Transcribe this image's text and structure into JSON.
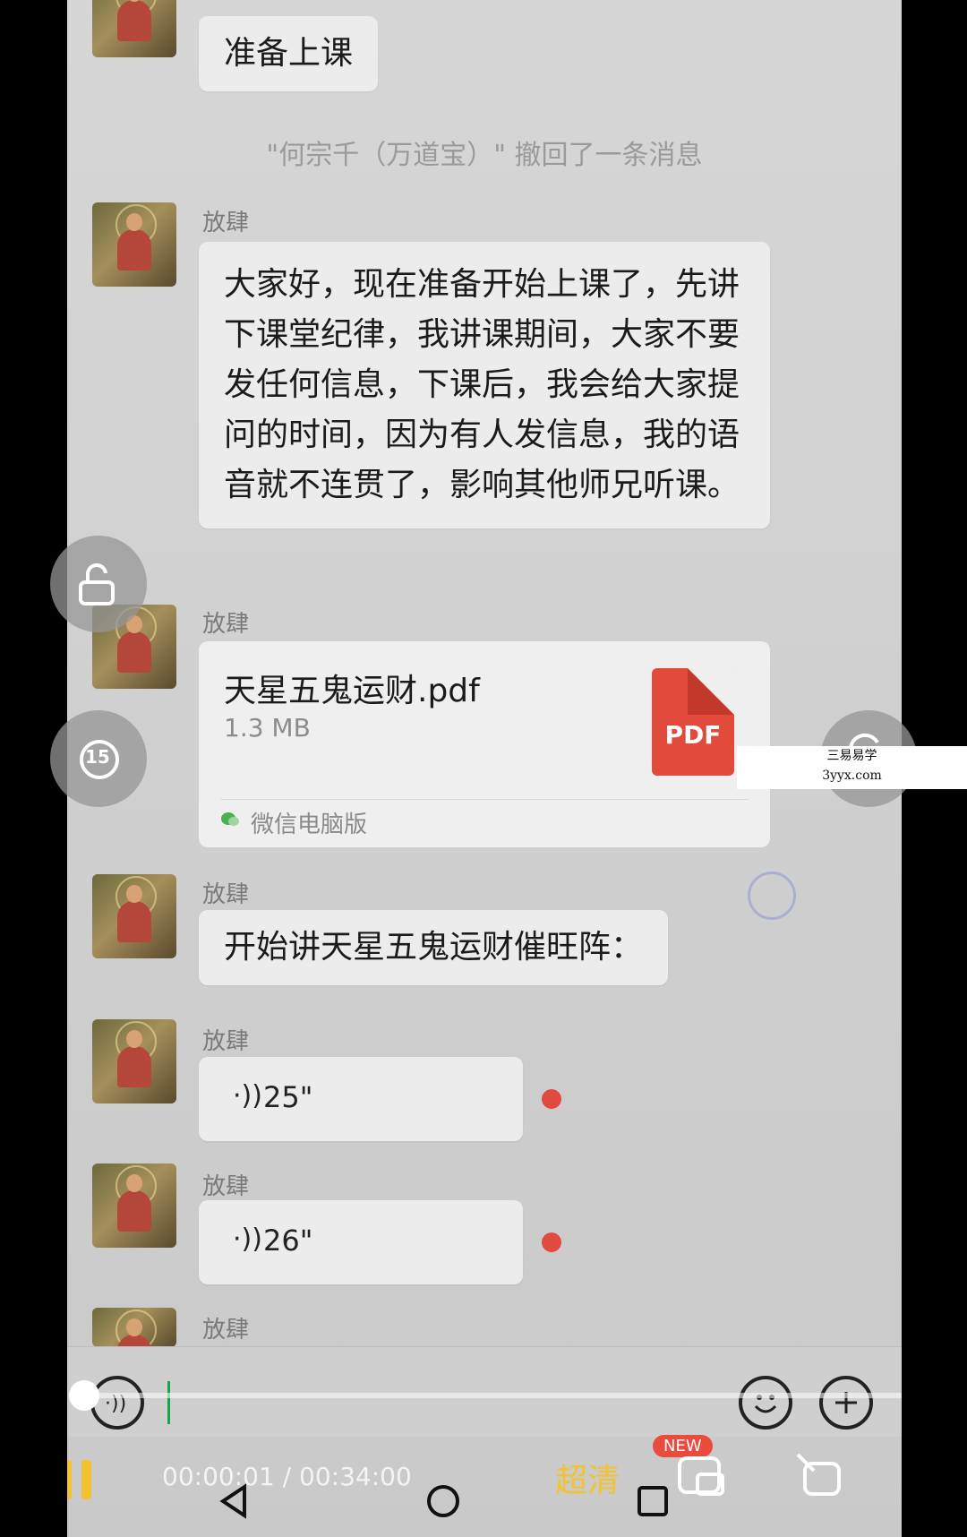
{
  "chat": {
    "system_recall": "\"何宗千（万道宝）\" 撤回了一条消息",
    "messages": [
      {
        "sender": "放肆",
        "text": "准备上课"
      },
      {
        "sender": "放肆",
        "text": "大家好，现在准备开始上课了，先讲下课堂纪律，我讲课期间，大家不要发任何信息，下课后，我会给大家提问的时间，因为有人发信息，我的语音就不连贯了，影响其他师兄听课。"
      },
      {
        "sender": "放肆",
        "file": {
          "name": "天星五鬼运财.pdf",
          "size": "1.3 MB",
          "badge": "PDF",
          "source": "微信电脑版"
        }
      },
      {
        "sender": "放肆",
        "text": "开始讲天星五鬼运财催旺阵："
      },
      {
        "sender": "放肆",
        "voice_duration": "25\""
      },
      {
        "sender": "放肆",
        "voice_duration": "26\""
      },
      {
        "sender": "放肆"
      }
    ]
  },
  "watermark": {
    "line1": "三易易学",
    "line2": "3yyx.com"
  },
  "player": {
    "time_current": "00:00:01",
    "time_total": "00:34:00",
    "time_separator": " / ",
    "quality_label": "超清",
    "new_badge": "NEW",
    "progress_fraction": 0.0005
  },
  "side_buttons": {
    "rewind_label": "15"
  },
  "colors": {
    "accent_yellow": "#f2c230",
    "unread_red": "#e04a3f",
    "new_badge_red": "#e94b3c"
  },
  "icons": [
    "lock-icon",
    "rewind-15-icon",
    "forward-icon",
    "voice-mode-icon",
    "emoji-icon",
    "plus-icon",
    "pause-icon",
    "pip-icon",
    "share-icon",
    "nav-back-icon",
    "nav-home-icon",
    "nav-recent-icon"
  ]
}
